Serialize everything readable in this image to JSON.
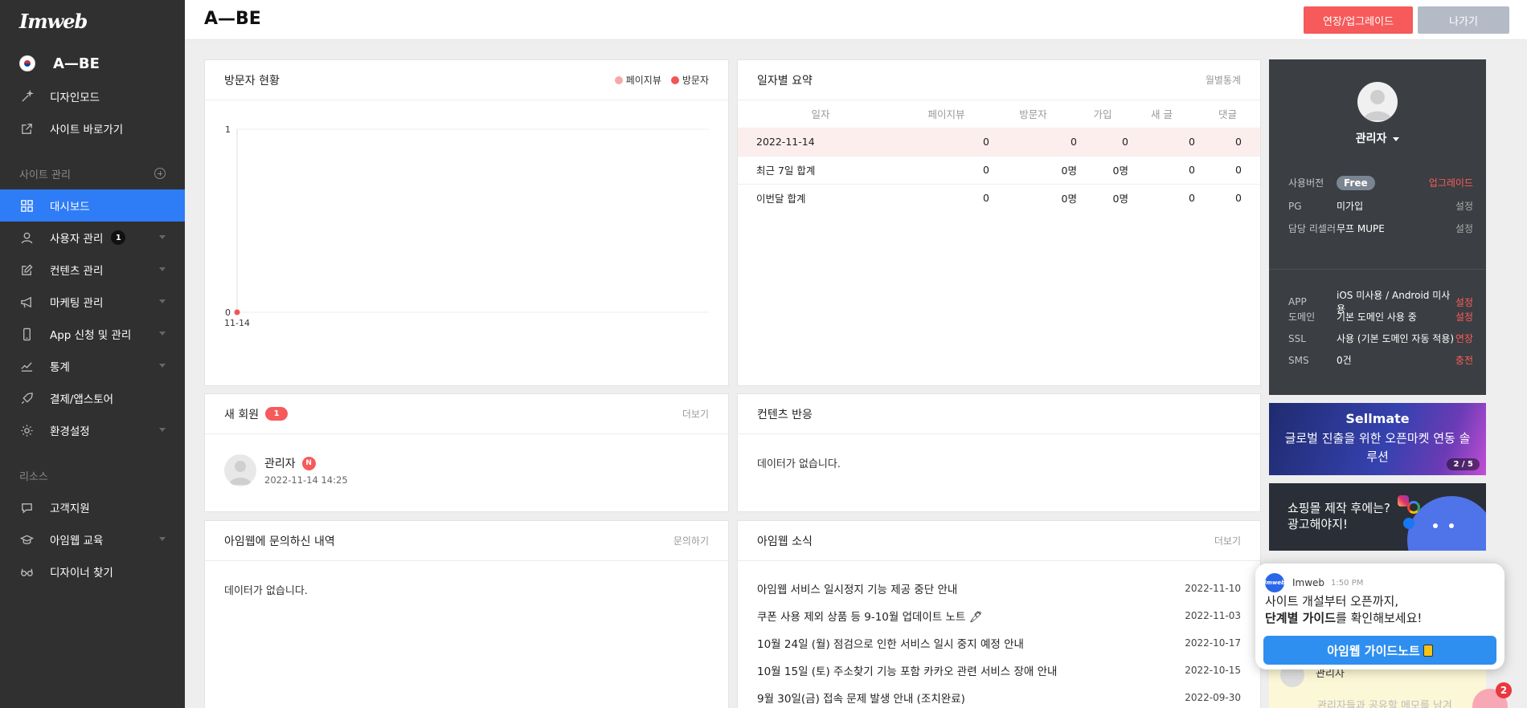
{
  "sidebar": {
    "logo": "Imweb",
    "site_name": "A—BE",
    "design_mode": "디자인모드",
    "site_shortcut": "사이트 바로가기",
    "section_site": "사이트 관리",
    "items": [
      {
        "label": "대시보드"
      },
      {
        "label": "사용자 관리",
        "badge": "1"
      },
      {
        "label": "컨텐츠 관리"
      },
      {
        "label": "마케팅 관리"
      },
      {
        "label": "App 신청 및 관리"
      },
      {
        "label": "통계"
      },
      {
        "label": "결제/앱스토어"
      },
      {
        "label": "환경설정"
      }
    ],
    "section_resource": "리소스",
    "resources": [
      {
        "label": "고객지원"
      },
      {
        "label": "아임웹 교육"
      },
      {
        "label": "디자이너 찾기"
      }
    ]
  },
  "header": {
    "title": "A—BE",
    "upgrade_btn": "연장/업그레이드",
    "exit_btn": "나가기"
  },
  "visitors": {
    "title": "방문자 현황",
    "legend_pageview": "페이지뷰",
    "legend_visitor": "방문자"
  },
  "chart_data": {
    "type": "line",
    "x": [
      "11-14"
    ],
    "series": [
      {
        "name": "페이지뷰",
        "values": [
          0
        ]
      },
      {
        "name": "방문자",
        "values": [
          0
        ]
      }
    ],
    "ylim": [
      0,
      1
    ],
    "yticks": [
      "0",
      "1"
    ],
    "colors": {
      "pageview": "#f7a8a8",
      "visitor": "#f25555"
    }
  },
  "daily": {
    "title": "일자별 요약",
    "more": "월별통계",
    "headers": [
      "일자",
      "페이지뷰",
      "방문자",
      "가입",
      "새 글",
      "댓글"
    ],
    "rows": [
      [
        "2022-11-14",
        "0",
        "0",
        "0",
        "0",
        "0"
      ],
      [
        "최근 7일 합계",
        "0",
        "0명",
        "0명",
        "0",
        "0"
      ],
      [
        "이번달 합계",
        "0",
        "0명",
        "0명",
        "0",
        "0"
      ]
    ]
  },
  "new_members": {
    "title": "새 회원",
    "badge": "1",
    "more": "더보기",
    "member_name": "관리자",
    "member_badge": "N",
    "member_date": "2022-11-14 14:25"
  },
  "content_reaction": {
    "title": "컨텐츠 반응",
    "empty": "데이터가 없습니다."
  },
  "inquiries": {
    "title": "아임웹에 문의하신 내역",
    "more": "문의하기",
    "empty": "데이터가 없습니다."
  },
  "news": {
    "title": "아임웹 소식",
    "more": "더보기",
    "items": [
      {
        "text": "아임웹 서비스 일시정지 기능 제공 중단 안내",
        "date": "2022-11-10"
      },
      {
        "text": "쿠폰 사용 제외 상품 등 9-10월 업데이트 노트 🖋",
        "date": "2022-11-03"
      },
      {
        "text": "10월 24일 (월) 점검으로 인한 서비스 일시 중지 예정 안내",
        "date": "2022-10-17"
      },
      {
        "text": "10월 15일 (토) 주소찾기 기능 포함 카카오 관련 서비스 장애 안내",
        "date": "2022-10-15"
      },
      {
        "text": "9월 30일(금) 접속 문제 발생 안내 (조치완료)",
        "date": "2022-09-30"
      }
    ]
  },
  "profile": {
    "name": "관리자",
    "rows": [
      {
        "k": "사용버전",
        "v": "Free",
        "a": "업그레이드"
      },
      {
        "k": "PG",
        "v": "미가입",
        "a": "설정"
      },
      {
        "k": "담당 리셀러",
        "v": "무프 MUPE",
        "a": "설정"
      },
      {
        "k": "APP",
        "v": "iOS 미사용 / Android 미사용",
        "a": "설정"
      },
      {
        "k": "도메인",
        "v": "기본 도메인 사용 중",
        "a": "설정"
      },
      {
        "k": "SSL",
        "v": "사용 (기본 도메인 자동 적용)",
        "a": "연장"
      },
      {
        "k": "SMS",
        "v": "0건",
        "a": "충전"
      }
    ]
  },
  "banner1": {
    "brand": "Sellmate",
    "line1": "글로벌 진출을 위한 오픈마켓 연동 솔",
    "line2": "루션",
    "page": "2 / 5"
  },
  "banner2": {
    "line1": "쇼핑몰 제작 후에는?",
    "line2": "광고해야지!"
  },
  "popup": {
    "logo": "Imweb",
    "sender": "Imweb",
    "time": "1:50 PM",
    "line1": "사이트 개설부터 오픈까지,",
    "line2_bold": "단계별 가이드",
    "line2_rest": "를 확인해보세요!",
    "cta": "아임웹 가이드노트"
  },
  "memo": {
    "name": "관리자",
    "text": "관리자들과 공유할 메모를 남겨"
  },
  "chat_count": "2"
}
